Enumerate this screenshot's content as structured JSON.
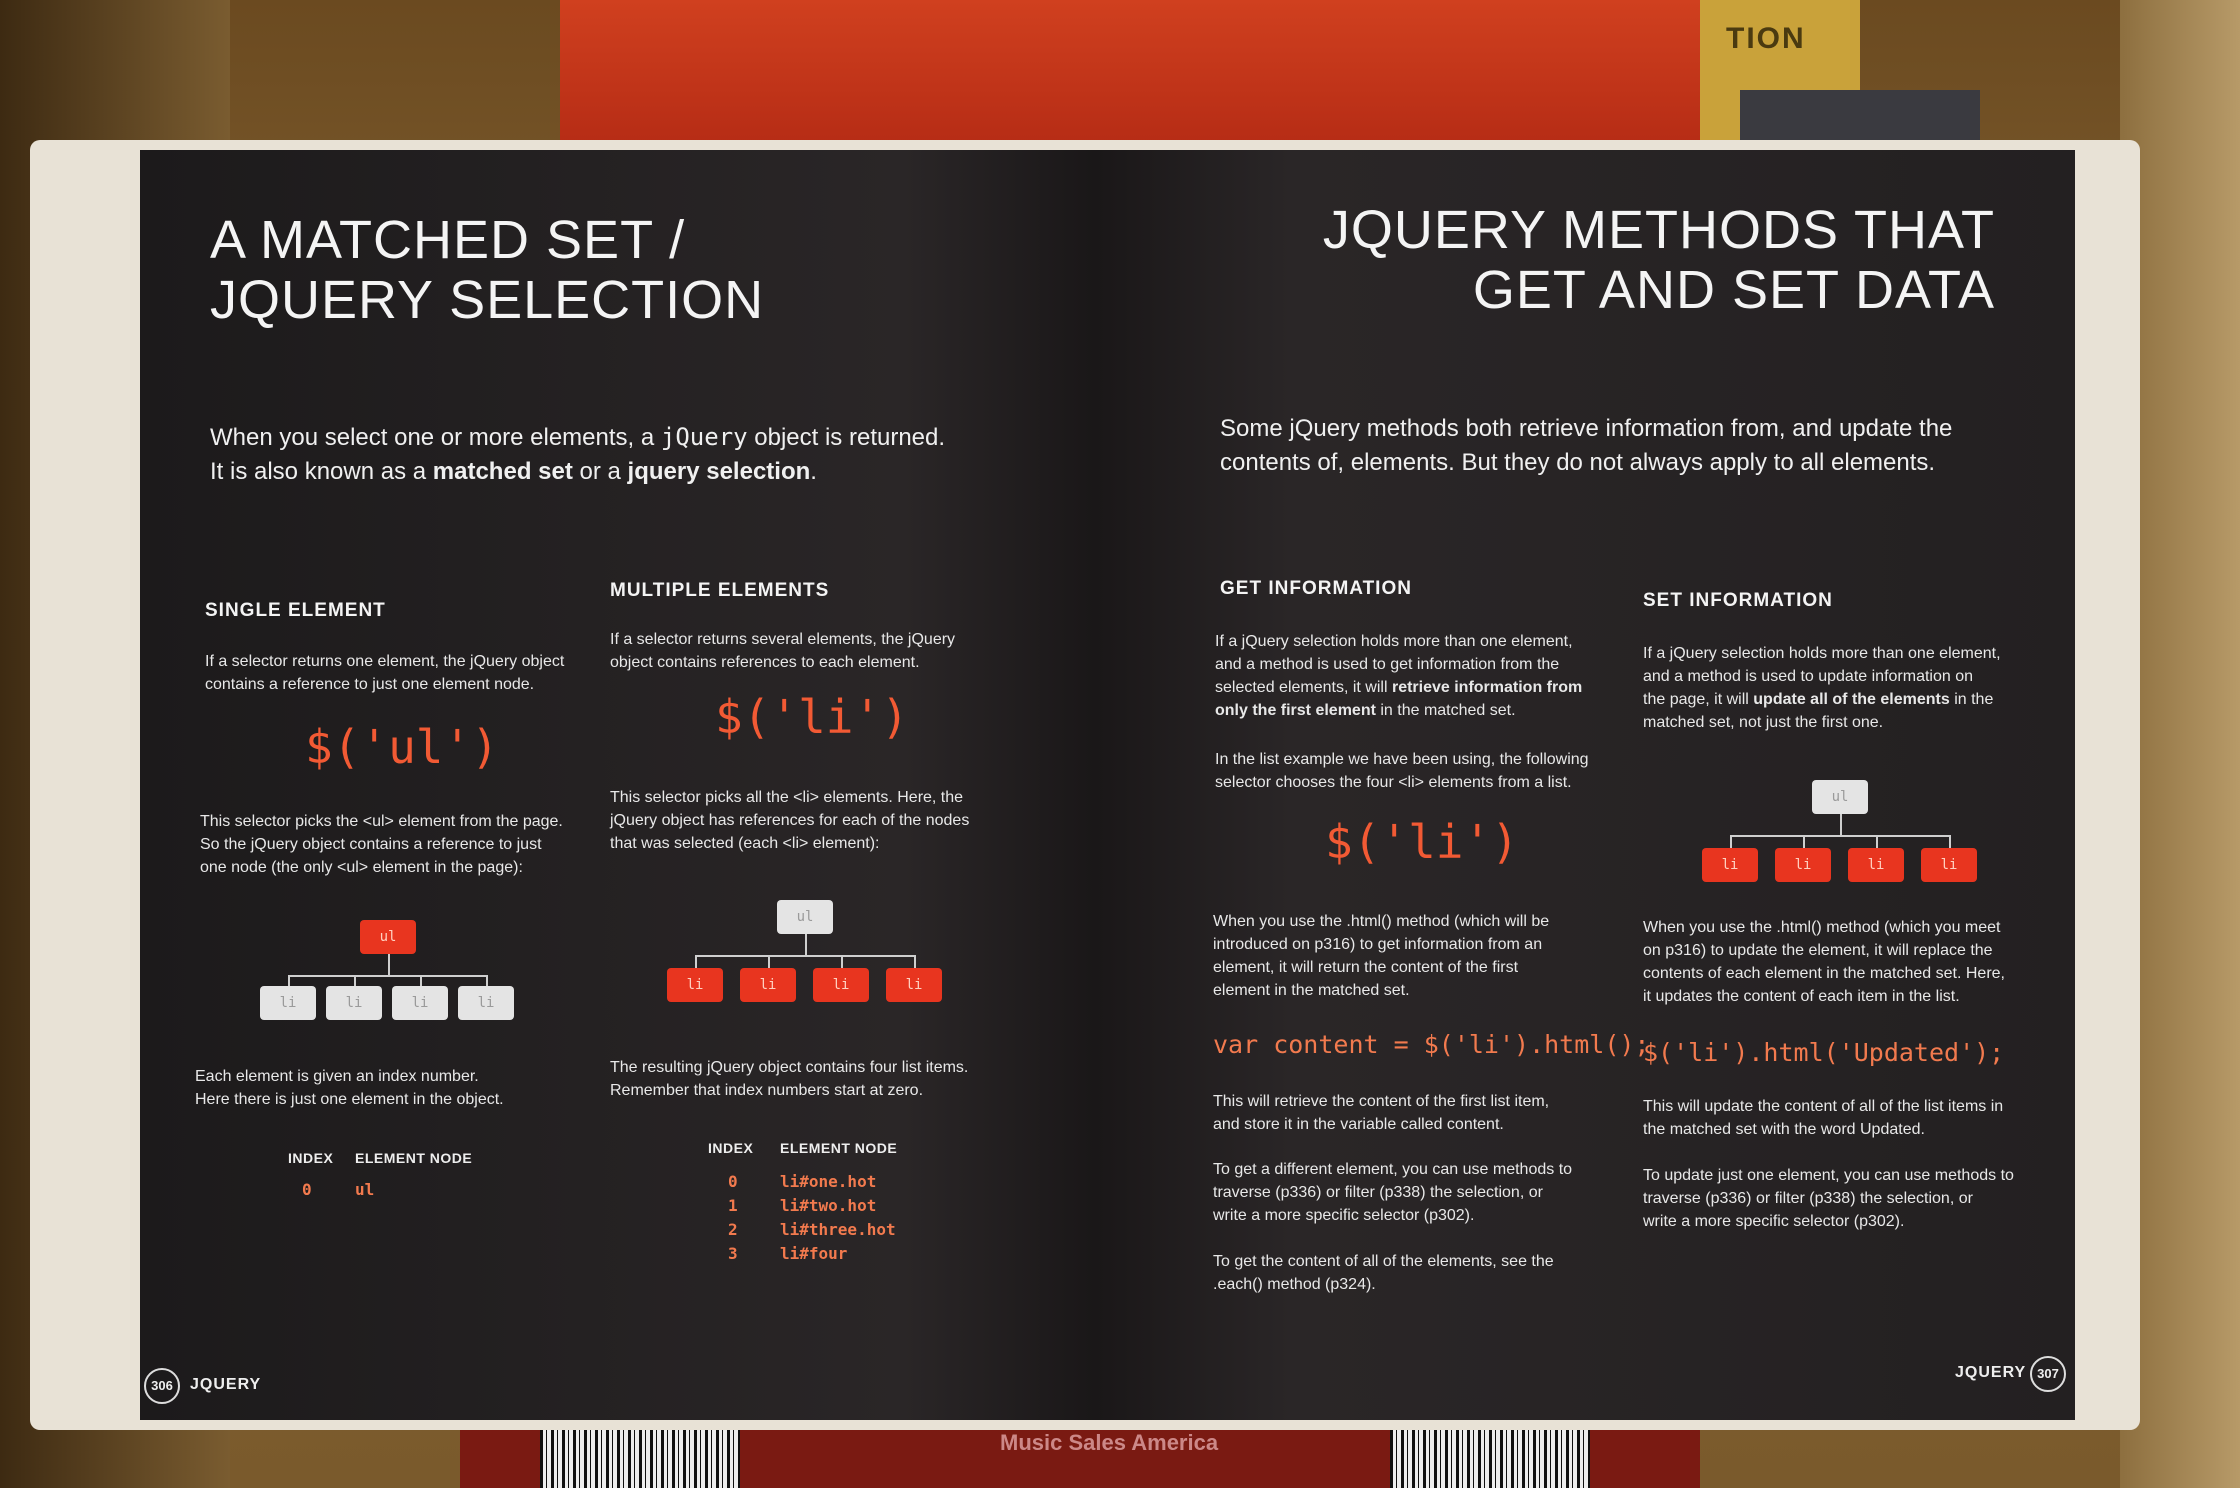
{
  "background": {
    "top_book_label": "TION",
    "bottom_label": "Music Sales America"
  },
  "left_page": {
    "title_line1": "A MATCHED SET /",
    "title_line2": "JQUERY SELECTION",
    "intro_line1_before": "When you select one or more elements, a ",
    "intro_line1_code": "jQuery",
    "intro_line1_after": " object is returned.",
    "intro_line2_before": "It is also known as a ",
    "intro_line2_b1": "matched set",
    "intro_line2_mid": " or a ",
    "intro_line2_b2": "jquery selection",
    "intro_line2_end": ".",
    "single": {
      "heading": "SINGLE ELEMENT",
      "desc1": "If a selector returns one element, the jQuery object",
      "desc2": "contains a reference to just one element node.",
      "selector": "$('ul')",
      "after1": "This selector picks the <ul> element from the page.",
      "after2": "So the jQuery object contains a reference to just",
      "after3": "one node (the only <ul> element in the page):",
      "root_label": "ul",
      "child_label": "li",
      "note1": "Each element is given an index number.",
      "note2": "Here there is just one element in the object.",
      "index_header": "INDEX",
      "node_header": "ELEMENT NODE",
      "rows": [
        {
          "index": "0",
          "node": "ul"
        }
      ]
    },
    "multiple": {
      "heading": "MULTIPLE ELEMENTS",
      "desc1": "If a selector returns several elements, the jQuery",
      "desc2": "object contains references to each element.",
      "selector": "$('li')",
      "after1": "This selector picks all the <li> elements. Here, the",
      "after2": "jQuery object has references for each of the nodes",
      "after3": "that was selected (each <li> element):",
      "root_label": "ul",
      "child_label": "li",
      "note1": "The resulting jQuery object contains four list items.",
      "note2": "Remember that index numbers start at zero.",
      "index_header": "INDEX",
      "node_header": "ELEMENT NODE",
      "rows": [
        {
          "index": "0",
          "node": "li#one.hot"
        },
        {
          "index": "1",
          "node": "li#two.hot"
        },
        {
          "index": "2",
          "node": "li#three.hot"
        },
        {
          "index": "3",
          "node": "li#four"
        }
      ]
    },
    "page_number": "306",
    "running_head": "JQUERY"
  },
  "right_page": {
    "title_line1": "JQUERY METHODS THAT",
    "title_line2": "GET AND SET DATA",
    "intro_line1": "Some jQuery methods both retrieve information from, and update the",
    "intro_line2": "contents of, elements.  But they do not always apply to all elements.",
    "get": {
      "heading": "GET INFORMATION",
      "p1_l1": "If a jQuery selection holds more than one element,",
      "p1_l2": "and a method is used to get information from the",
      "p1_l3_before": "selected elements, it will ",
      "p1_l3_bold": "retrieve information from",
      "p1_l4_bold": "only the first element",
      "p1_l4_after": " in the matched set.",
      "p2_l1": "In the list example we have been using, the following",
      "p2_l2": "selector chooses the four <li> elements from a list.",
      "selector": "$('li')",
      "p3_l1": "When you use the .html() method (which will be",
      "p3_l2": "introduced on p316) to get information from an",
      "p3_l3": "element, it will return the content of the first",
      "p3_l4": "element in the matched set.",
      "code": "var content = $('li').html();",
      "p4_l1": "This will retrieve the content of the first list item,",
      "p4_l2": "and store it in the variable called content.",
      "p5_l1": "To get a different element, you can use methods to",
      "p5_l2": "traverse (p336) or filter (p338) the selection, or",
      "p5_l3": "write a more specific selector (p302).",
      "p6_l1": "To get the content of all of the elements, see the",
      "p6_l2": ".each() method (p324)."
    },
    "set": {
      "heading": "SET INFORMATION",
      "p1_l1": "If a jQuery selection holds more than one element,",
      "p1_l2": "and a method is used to update information on",
      "p1_l3_before": "the page, it will ",
      "p1_l3_bold": "update all of the elements",
      "p1_l3_after": " in the",
      "p1_l4": "matched set, not just the first one.",
      "root_label": "ul",
      "child_label": "li",
      "p2_l1": "When you use the .html() method (which you meet",
      "p2_l2": "on p316) to update the element, it will replace the",
      "p2_l3": "contents of each element in the matched set. Here,",
      "p2_l4": "it updates the content of each item in the list.",
      "code": "$('li').html('Updated');",
      "p3_l1": "This will update the content of all of the list items in",
      "p3_l2": "the matched set with the word Updated.",
      "p4_l1": "To update just one element, you can use methods to",
      "p4_l2": "traverse (p336) or filter (p338) the selection, or",
      "p4_l3": "write a more specific selector (p302)."
    },
    "page_number": "307",
    "running_head": "JQUERY"
  },
  "colors": {
    "accent": "#e8351f",
    "page": "#231f20",
    "code": "#f27a4e"
  }
}
